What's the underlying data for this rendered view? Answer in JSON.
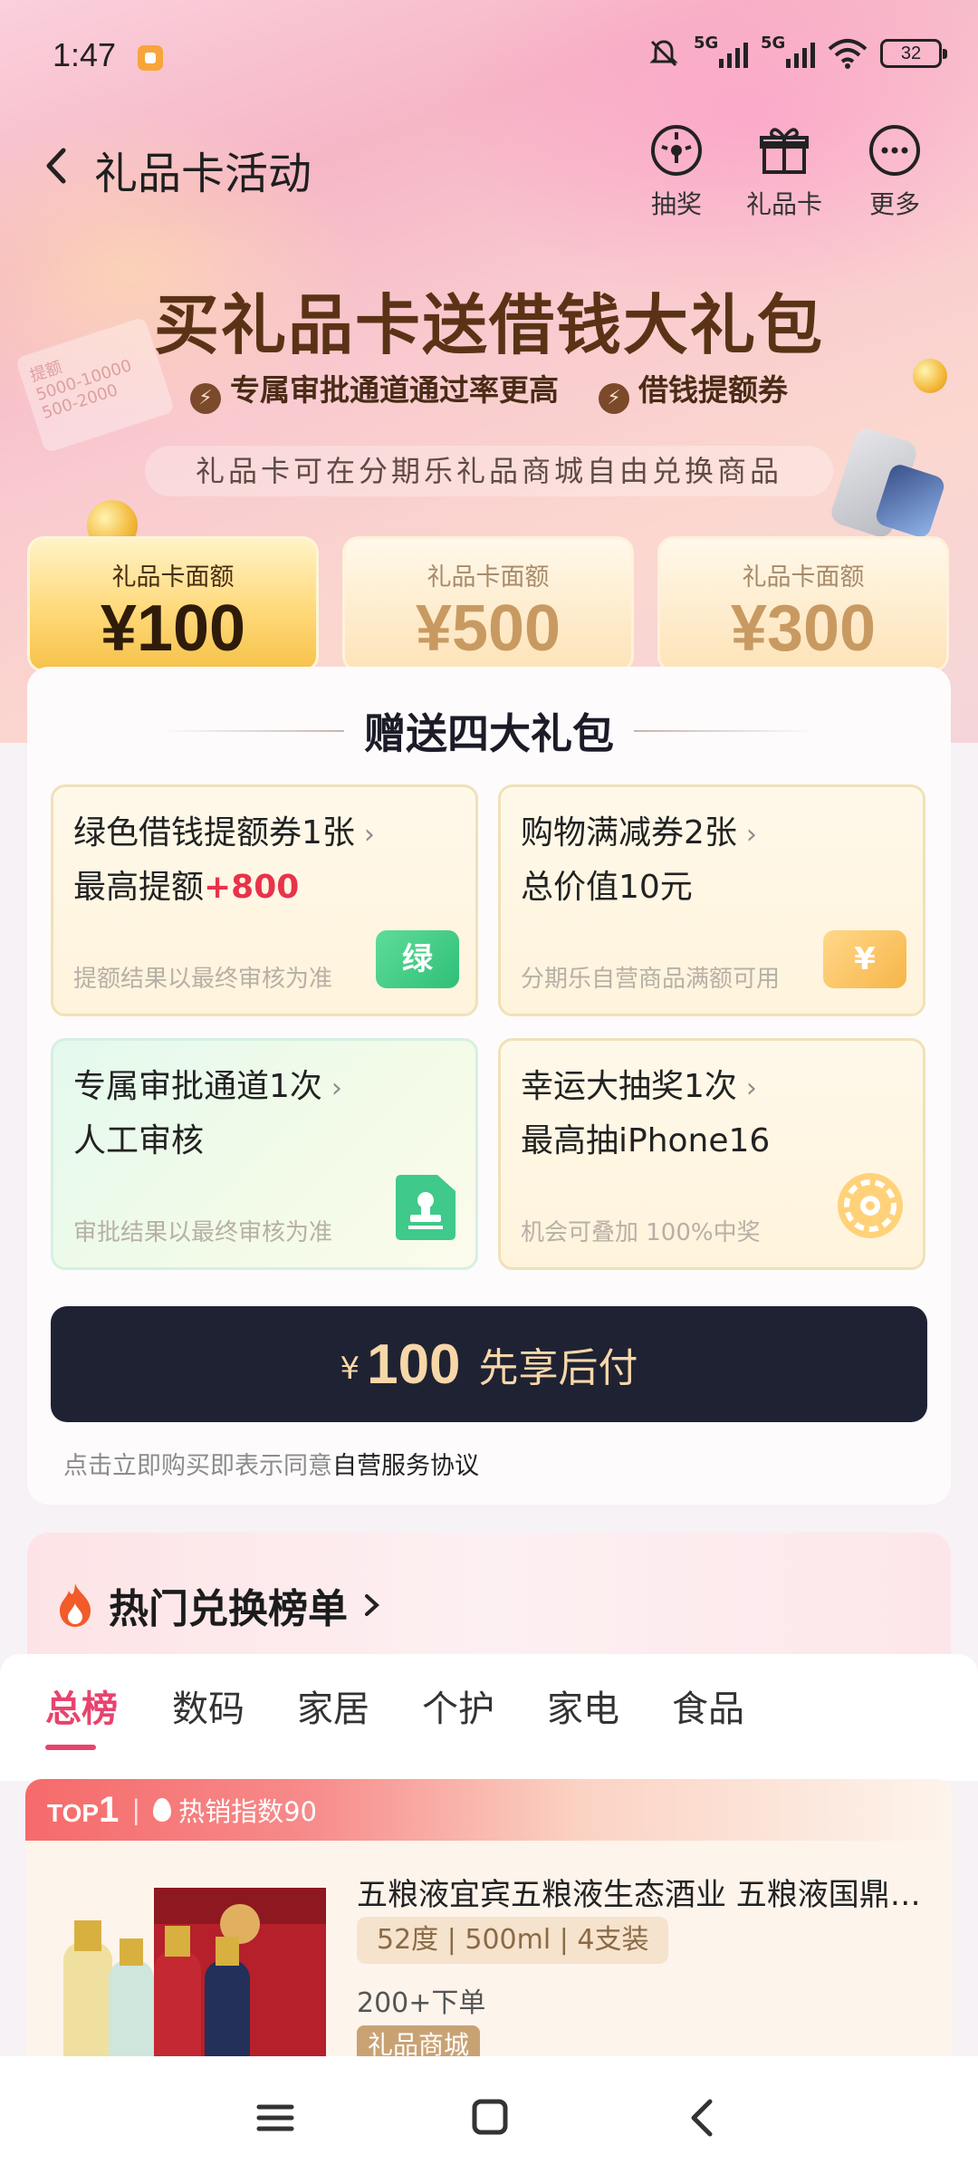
{
  "status_bar": {
    "time": "1:47",
    "network_1": "5G",
    "network_2": "5G",
    "battery": "32"
  },
  "nav": {
    "title": "礼品卡活动",
    "actions": [
      {
        "label": "抽奖",
        "icon": "lottery-dial-icon"
      },
      {
        "label": "礼品卡",
        "icon": "gift-box-icon"
      },
      {
        "label": "更多",
        "icon": "more-dots-icon"
      }
    ]
  },
  "hero": {
    "title": "买礼品卡送借钱大礼包",
    "subtitle_1": "专属审批通道通过率更高",
    "subtitle_2": "借钱提额券",
    "note": "礼品卡可在分期乐礼品商城自由兑换商品",
    "ticket_1": "提额",
    "ticket_2": "5000-10000",
    "ticket_3": "500-2000"
  },
  "amounts": [
    {
      "label": "礼品卡面额",
      "value": "¥100",
      "selected": true
    },
    {
      "label": "礼品卡面额",
      "value": "¥500",
      "selected": false
    },
    {
      "label": "礼品卡面额",
      "value": "¥300",
      "selected": false
    }
  ],
  "gift": {
    "heading": "赠送四大礼包",
    "packages": [
      {
        "line1": "绿色借钱提额券1张",
        "line2_prefix": "最高提额",
        "line2_highlight": "+800",
        "note": "提额结果以最终审核为准",
        "icon": "green-ticket-icon",
        "icon_text": "绿"
      },
      {
        "line1": "购物满减券2张",
        "line2_prefix": "总价值10元",
        "line2_highlight": "",
        "note": "分期乐自营商品满额可用",
        "icon": "yuan-ticket-icon",
        "icon_text": "¥"
      },
      {
        "line1": "专属审批通道1次",
        "line2_prefix": "人工审核",
        "line2_highlight": "",
        "note": "审批结果以最终审核为准",
        "icon": "approval-stamp-icon",
        "icon_text": ""
      },
      {
        "line1": "幸运大抽奖1次",
        "line2_prefix": "最高抽iPhone16",
        "line2_highlight": "",
        "note": "机会可叠加 100%中奖",
        "icon": "lucky-wheel-icon",
        "icon_text": ""
      }
    ],
    "pay_button": {
      "currency": "¥",
      "amount": "100",
      "text": "先享后付"
    },
    "agreement_prefix": "点击立即购买即表示同意",
    "agreement_link": "自营服务协议"
  },
  "ranking": {
    "title": "热门兑换榜单",
    "tabs": [
      "总榜",
      "数码",
      "家居",
      "个护",
      "家电",
      "食品"
    ],
    "active_tab": "总榜",
    "product": {
      "rank_word": "TOP",
      "rank_num": "1",
      "hot_index": "热销指数90",
      "name": "五粮液宜宾五粮液生态酒业 五粮液国鼎…",
      "spec": "52度 | 500ml | 4支装",
      "sold": "200+下单",
      "badge": "礼品商城"
    }
  },
  "colors": {
    "accent_pink": "#e8436d",
    "price_red": "#e8334a",
    "pay_dark": "#1f2233",
    "pay_gold": "#f7d7a8"
  }
}
